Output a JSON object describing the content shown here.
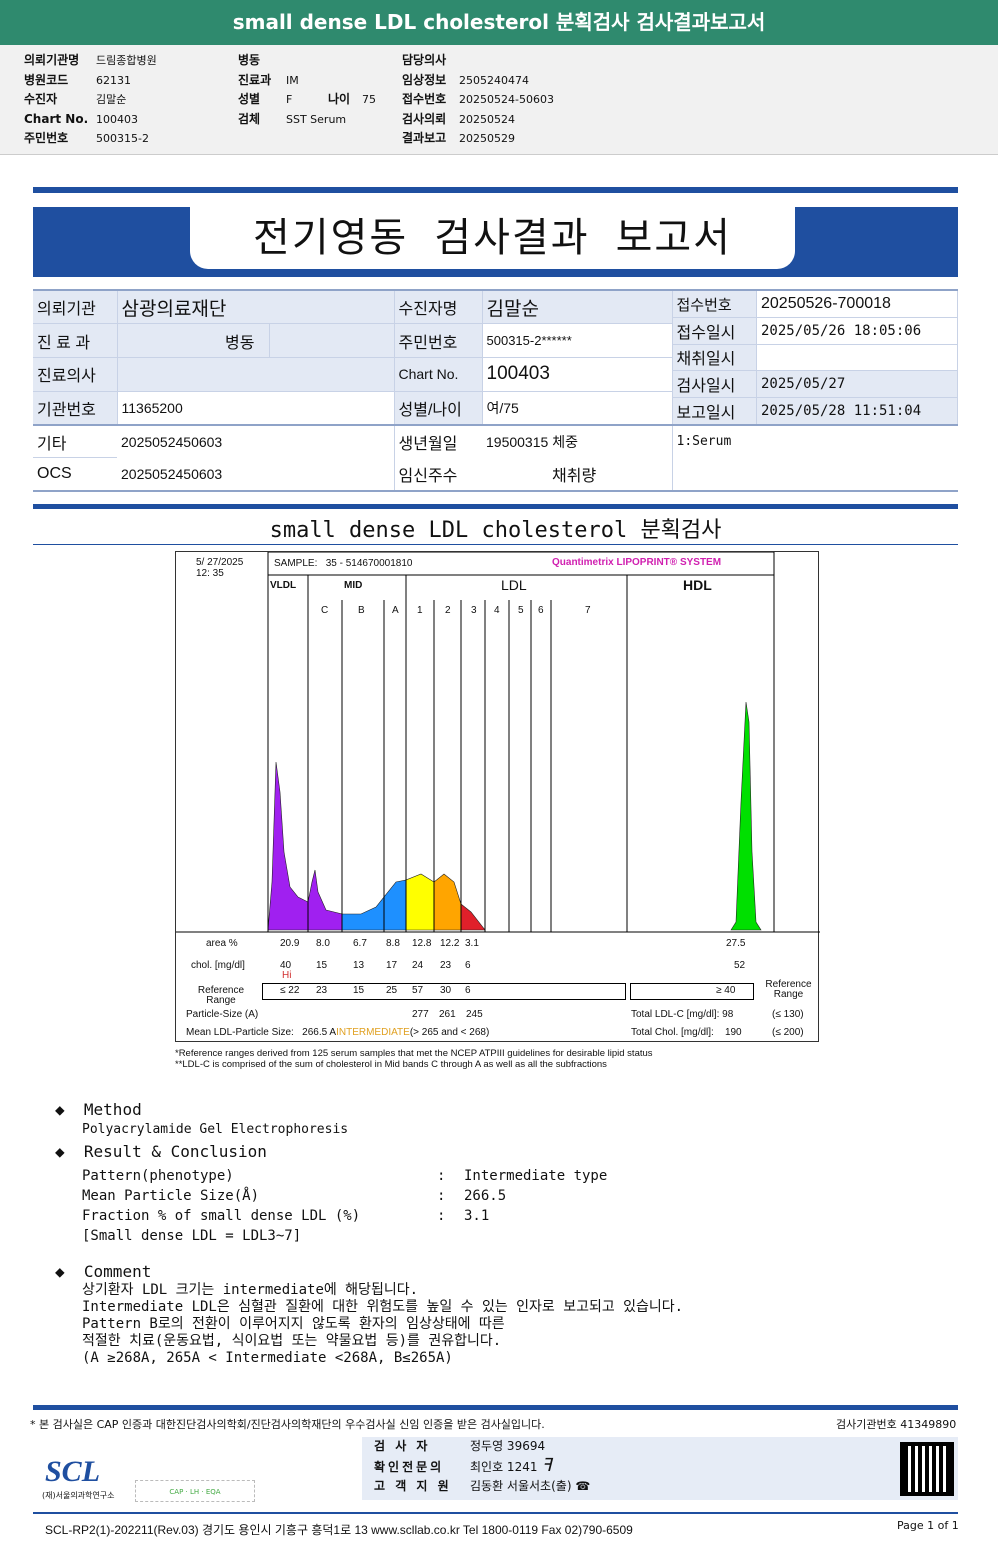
{
  "header": {
    "title": "small dense LDL cholesterol 분획검사 검사결과보고서"
  },
  "info": {
    "col1": [
      {
        "label": "의뢰기관명",
        "value": "드림종합병원"
      },
      {
        "label": "병원코드",
        "value": "62131"
      },
      {
        "label": "수진자",
        "value": "김말순"
      },
      {
        "label": "Chart No.",
        "value": "100403"
      },
      {
        "label": "주민번호",
        "value": "500315-2"
      }
    ],
    "col2": [
      {
        "label": "병동",
        "value": ""
      },
      {
        "label": "진료과",
        "value": "IM"
      },
      {
        "label": "성별",
        "value": "F"
      },
      {
        "label": "검체",
        "value": "SST Serum"
      }
    ],
    "age_label": "나이",
    "age": "75",
    "col3": [
      {
        "label": "담당의사",
        "value": ""
      },
      {
        "label": "임상정보",
        "value": "2505240474"
      },
      {
        "label": "접수번호",
        "value": "20250524-50603"
      },
      {
        "label": "검사의뢰",
        "value": "20250524"
      },
      {
        "label": "결과보고",
        "value": "20250529"
      }
    ]
  },
  "report": {
    "title": "전기영동 검사결과 보고서",
    "rows": {
      "inst_label": "의뢰기관",
      "inst": "삼광의료재단",
      "name_label": "수진자명",
      "name": "김말순",
      "recv_no_label": "접수번호",
      "recv_no": "20250526-700018",
      "dept_label": "진 료 과",
      "ward_label": "병동",
      "rrn_label": "주민번호",
      "rrn": "500315-2******",
      "recv_dt_label": "접수일시",
      "recv_dt": "2025/05/26 18:05:06",
      "coll_label": "채취일시",
      "doctor_label": "진료의사",
      "chart_label": "Chart No.",
      "chart": "100403",
      "test_dt_label": "검사일시",
      "test_dt": "2025/05/27",
      "instno_label": "기관번호",
      "instno": "11365200",
      "sexage_label": "성별/나이",
      "sexage": "여/75",
      "report_dt_label": "보고일시",
      "report_dt": "2025/05/28 11:51:04",
      "etc_label": "기타",
      "etc": "2025052450603",
      "birth_label": "생년월일",
      "birth": "19500315",
      "weight_label": "체중",
      "specimen": "1:Serum",
      "ocs_label": "OCS",
      "ocs": "2025052450603",
      "preg_label": "임신주수",
      "vol_label": "채취량"
    }
  },
  "subtitle": "small dense LDL cholesterol 분획검사",
  "lipoprint": {
    "date": "5/ 27/2025",
    "time": "12: 35",
    "sample_label": "SAMPLE:",
    "sample": "35 - 514670001810",
    "brand": "Quantimetrix LIPOPRINT® SYSTEM",
    "groups": [
      "VLDL",
      "MID",
      "LDL",
      "HDL"
    ],
    "bands": [
      "C",
      "B",
      "A",
      "1",
      "2",
      "3",
      "4",
      "5",
      "6",
      "7"
    ],
    "area_label": "area %",
    "area": [
      "20.9",
      "8.0",
      "6.7",
      "8.8",
      "12.8",
      "12.2",
      "3.1"
    ],
    "area_hdl": "27.5",
    "chol_label": "chol. [mg/dl]",
    "chol": [
      "40",
      "15",
      "13",
      "17",
      "24",
      "23",
      "6"
    ],
    "chol_hdl": "52",
    "flag": "Hi",
    "ref_label": "Reference Range",
    "ref": [
      "≤ 22",
      "23",
      "15",
      "25",
      "57",
      "30",
      "6"
    ],
    "ref_hdl": "≥ 40",
    "ps_label": "Particle-Size (A)",
    "ps": [
      "277",
      "261",
      "245"
    ],
    "mean_label": "Mean LDL-Particle Size:",
    "mean": "266.5 A",
    "mean_class": "INTERMEDIATE",
    "mean_range": "(> 265 and < 268)",
    "tldl_label": "Total LDL-C [mg/dl]:",
    "tldl": "98",
    "tldl_ref": "(≤ 130)",
    "tchol_label": "Total Chol. [mg/dl]:",
    "tchol": "190",
    "tchol_ref": "(≤ 200)",
    "note1": "*Reference ranges derived from 125 serum samples that met the NCEP ATPIII guidelines for desirable lipid status",
    "note2": "**LDL-C is comprised of the sum of cholesterol in Mid bands C through A as well as all the subfractions",
    "colors": {
      "vldl": "#a020f0",
      "mid": "#1e90ff",
      "ldl1": "#ffff00",
      "ldl2": "#ffa500",
      "ldl3": "#e0202a",
      "hdl": "#00e000"
    }
  },
  "method": {
    "title": "Method",
    "text": "Polyacrylamide Gel Electrophoresis"
  },
  "result": {
    "title": "Result & Conclusion",
    "rows": [
      {
        "label": "Pattern(phenotype)",
        "value": "Intermediate type"
      },
      {
        "label": "Mean Particle Size(Å)",
        "value": "266.5"
      },
      {
        "label": "Fraction % of small dense LDL (%)",
        "value": "3.1"
      }
    ],
    "note": "[Small dense LDL = LDL3~7]"
  },
  "comment": {
    "title": "Comment",
    "lines": [
      "상기환자 LDL 크기는 intermediate에 해당됩니다.",
      "Intermediate LDL은 심혈관 질환에 대한 위험도를 높일 수 있는 인자로 보고되고 있습니다.",
      "Pattern B로의 전환이 이루어지지 않도록 환자의 임상상태에 따른",
      "적절한 치료(운동요법, 식이요법 또는 약물요법 등)를 권유합니다.",
      "(A ≥268A, 265A < Intermediate <268A, B≤265A)"
    ]
  },
  "footer": {
    "cert": "* 본 검사실은 CAP 인증과 대한진단검사의학회/진단검사의학재단의 우수검사실 신임 인증을 받은 검사실입니다.",
    "labno": "검사기관번호 41349890",
    "tester_label": "검 사 자",
    "tester": "정두영 39694",
    "confirm_label": "확인전문의",
    "confirm": "최인호 1241",
    "support_label": "고 객 지 원",
    "support": "김동환 서울서초(출)",
    "logo": "SCL",
    "logo_sub": "(재)서울의과학연구소",
    "address": "SCL-RP2(1)-202211(Rev.03) 경기도 용인시 기흥구 흥덕1로 13 www.scllab.co.kr Tel 1800-0119 Fax 02)790-6509",
    "page": "Page 1 of 1"
  }
}
